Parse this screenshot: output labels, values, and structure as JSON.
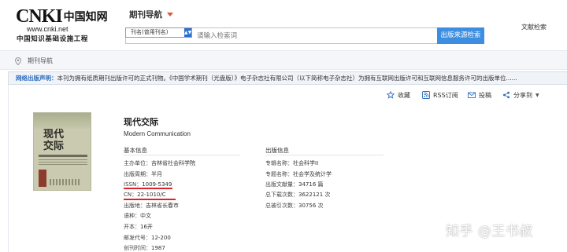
{
  "logo": {
    "brand": "CNKI",
    "brand_cn": "中国知网",
    "url": "www.cnki.net",
    "subtitle": "中国知识基础设施工程"
  },
  "header": {
    "nav_title": "期刊导航",
    "search_field_option": "刊名(曾用刊名)",
    "search_placeholder": "请输入检索词",
    "search_button": "出版来源检索",
    "literature_search": "文献检索"
  },
  "breadcrumb": {
    "label": "期刊导航"
  },
  "notice": {
    "label": "网络出版声明：",
    "text": "本刊为拥有纸质期刊出版许可的正式刊物。《中国学术期刊（光盘版）》电子杂志社有限公司（以下简称电子杂志社）为拥有互联网出版许可和互联网信息服务许可的出版单位......"
  },
  "actions": [
    {
      "label": "收藏",
      "icon": "star-icon"
    },
    {
      "label": "RSS订阅",
      "icon": "rss-icon"
    },
    {
      "label": "投稿",
      "icon": "mail-icon"
    },
    {
      "label": "分享到",
      "icon": "share-icon"
    }
  ],
  "cover": {
    "title": "现代交际"
  },
  "journal": {
    "title": "现代交际",
    "english_title": "Modern Communication"
  },
  "basic_info": {
    "heading": "基本信息",
    "rows": [
      {
        "label": "主办单位：",
        "value": "吉林省社会科学院"
      },
      {
        "label": "出版周期：",
        "value": "半月"
      },
      {
        "label": "ISSN：",
        "value": "1009-5349"
      },
      {
        "label": "CN：",
        "value": "22-1010/C"
      },
      {
        "label": "出版地：",
        "value": "吉林省长春市"
      },
      {
        "label": "语种：",
        "value": "中文"
      },
      {
        "label": "开本：",
        "value": "16开"
      },
      {
        "label": "邮发代号：",
        "value": "12-200"
      },
      {
        "label": "创刊时间：",
        "value": "1987"
      }
    ]
  },
  "publish_info": {
    "heading": "出版信息",
    "rows": [
      {
        "label": "专辑名称：",
        "value": "社会科学II"
      },
      {
        "label": "专题名称：",
        "value": "社会学及统计学"
      },
      {
        "label": "出版文献量：",
        "value": "34716 篇"
      },
      {
        "label": "总下载次数：",
        "value": "3622121 次"
      },
      {
        "label": "总被引次数：",
        "value": "30756 次"
      }
    ]
  },
  "watermark": "知乎 @王书叔",
  "colors": {
    "accent_blue": "#3d8ee0",
    "notice_label": "#2f6fbd",
    "highlight_red": "#d6262a",
    "caret_orange": "#e0543a"
  }
}
